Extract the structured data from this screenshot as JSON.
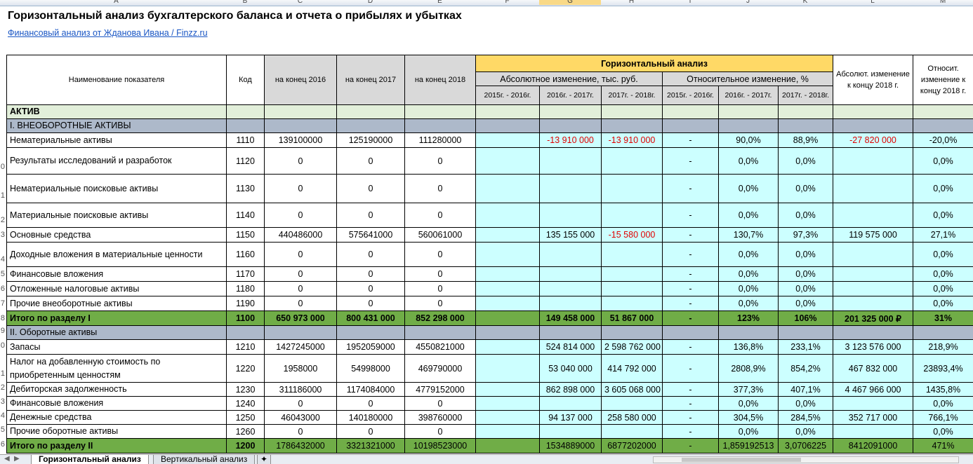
{
  "sheet": {
    "col_letters": [
      "A",
      "B",
      "C",
      "D",
      "E",
      "F",
      "G",
      "H",
      "I",
      "J",
      "K",
      "L",
      "M"
    ],
    "selected_col": "G",
    "title": "Горизонтальный анализ бухгалтерского баланса и отчета о прибылях и убытках",
    "link": "Финансовый анализ от Жданова Ивана / Finzz.ru"
  },
  "header": {
    "name": "Наименование показателя",
    "code": "Код",
    "y2016": "на конец 2016",
    "y2017": "на конец 2017",
    "y2018": "на конец 2018",
    "horizontal": "Горизонтальный анализ",
    "abs_change": "Абсолютное изменение, тыс. руб.",
    "rel_change": "Относительное изменение, %",
    "abs_2018": "Абсолют. изменение к концу 2018 г.",
    "rel_2018": "Относит. изменение к концу 2018 г.",
    "abs_periods": [
      "2015г. - 2016г.",
      "2016г. - 2017г.",
      "2017г. - 2018г."
    ],
    "rel_periods": [
      "2015г. - 2016г.",
      "2016г. - 2017г.",
      "2017г. - 2018г."
    ]
  },
  "rows": [
    {
      "type": "aktiv",
      "name": "АКТИВ",
      "rownum": ""
    },
    {
      "type": "section",
      "name": "I. ВНЕОБОРОТНЫЕ АКТИВЫ",
      "rownum": ""
    },
    {
      "type": "data",
      "rownum": "",
      "name": "Нематериальные активы",
      "code": "1110",
      "v16": "139100000",
      "v17": "125190000",
      "v18": "111280000",
      "a1": "",
      "a2": "-13 910 000",
      "a3": "-13 910 000",
      "r1": "-",
      "r2": "90,0%",
      "r3": "88,9%",
      "ab": "-27 820 000",
      "rel": "-20,0%",
      "neg": [
        "a2",
        "a3",
        "ab"
      ],
      "h": 21
    },
    {
      "type": "data",
      "rownum": "0",
      "name": "Результаты исследований и разработок",
      "code": "1120",
      "v16": "0",
      "v17": "0",
      "v18": "0",
      "a1": "",
      "a2": "",
      "a3": "",
      "r1": "-",
      "r2": "0,0%",
      "r3": "0,0%",
      "ab": "",
      "rel": "0,0%",
      "h": 38
    },
    {
      "type": "data",
      "rownum": "1",
      "name": "Нематериальные поисковые активы",
      "code": "1130",
      "v16": "0",
      "v17": "0",
      "v18": "0",
      "a1": "",
      "a2": "",
      "a3": "",
      "r1": "-",
      "r2": "0,0%",
      "r3": "0,0%",
      "ab": "",
      "rel": "0,0%",
      "h": 41
    },
    {
      "type": "data",
      "rownum": "2",
      "name": "Материальные поисковые активы",
      "code": "1140",
      "v16": "0",
      "v17": "0",
      "v18": "0",
      "a1": "",
      "a2": "",
      "a3": "",
      "r1": "-",
      "r2": "0,0%",
      "r3": "0,0%",
      "ab": "",
      "rel": "0,0%",
      "h": 35
    },
    {
      "type": "data",
      "rownum": "3",
      "name": "Основные средства",
      "code": "1150",
      "v16": "440486000",
      "v17": "575641000",
      "v18": "560061000",
      "a1": "",
      "a2": "135 155 000",
      "a3": "-15 580 000",
      "r1": "-",
      "r2": "130,7%",
      "r3": "97,3%",
      "ab": "119 575 000",
      "rel": "27,1%",
      "neg": [
        "a3"
      ],
      "h": 21
    },
    {
      "type": "data",
      "rownum": "4",
      "name": "Доходные вложения в материальные ценности",
      "code": "1160",
      "v16": "0",
      "v17": "0",
      "v18": "0",
      "a1": "",
      "a2": "",
      "a3": "",
      "r1": "-",
      "r2": "0,0%",
      "r3": "0,0%",
      "ab": "",
      "rel": "0,0%",
      "h": 35
    },
    {
      "type": "data",
      "rownum": "5",
      "name": "Финансовые вложения",
      "code": "1170",
      "v16": "0",
      "v17": "0",
      "v18": "0",
      "a1": "",
      "a2": "",
      "a3": "",
      "r1": "-",
      "r2": "0,0%",
      "r3": "0,0%",
      "ab": "",
      "rel": "0,0%",
      "h": 21
    },
    {
      "type": "data",
      "rownum": "6",
      "name": "Отложенные налоговые активы",
      "code": "1180",
      "v16": "0",
      "v17": "0",
      "v18": "0",
      "a1": "",
      "a2": "",
      "a3": "",
      "r1": "-",
      "r2": "0,0%",
      "r3": "0,0%",
      "ab": "",
      "rel": "0,0%",
      "h": 21
    },
    {
      "type": "data",
      "rownum": "7",
      "name": "Прочие внеоборотные активы",
      "code": "1190",
      "v16": "0",
      "v17": "0",
      "v18": "0",
      "a1": "",
      "a2": "",
      "a3": "",
      "r1": "-",
      "r2": "0,0%",
      "r3": "0,0%",
      "ab": "",
      "rel": "0,0%",
      "h": 21
    },
    {
      "type": "total",
      "rownum": "8",
      "name": "Итого по разделу I",
      "code": "1100",
      "v16": "650 973 000",
      "v17": "800 431 000",
      "v18": "852 298 000",
      "a1": "",
      "a2": "149 458 000",
      "a3": "51 867 000",
      "r1": "-",
      "r2": "123%",
      "r3": "106%",
      "ab": "201 325 000 ₽",
      "rel": "31%",
      "h": 21
    },
    {
      "type": "section",
      "rownum": "9",
      "name": "II. Оборотные активы"
    },
    {
      "type": "data",
      "rownum": "0",
      "name": "Запасы",
      "code": "1210",
      "small": true,
      "v16": "1427245000",
      "v17": "1952059000",
      "v18": "4550821000",
      "a1": "",
      "a2": "524 814 000",
      "a3": "2 598 762 000",
      "r1": "-",
      "r2": "136,8%",
      "r3": "233,1%",
      "ab": "3 123 576 000",
      "rel": "218,9%",
      "h": 21
    },
    {
      "type": "data",
      "rownum": "1",
      "name": "Налог на добавленную стоимость по приобретенным ценностям",
      "code": "1220",
      "small": true,
      "v16": "1958000",
      "v17": "54998000",
      "v18": "469790000",
      "a1": "",
      "a2": "53 040 000",
      "a3": "414 792 000",
      "r1": "-",
      "r2": "2808,9%",
      "r3": "854,2%",
      "ab": "467 832 000",
      "rel": "23893,4%",
      "h": 40
    },
    {
      "type": "data",
      "rownum": "2",
      "name": "Дебиторская задолженность",
      "code": "1230",
      "small": true,
      "v16": "311186000",
      "v17": "1174084000",
      "v18": "4779152000",
      "a1": "",
      "a2": "862 898 000",
      "a3": "3 605 068 000",
      "r1": "-",
      "r2": "377,3%",
      "r3": "407,1%",
      "ab": "4 467 966 000",
      "rel": "1435,8%",
      "h": 20
    },
    {
      "type": "data",
      "rownum": "3",
      "name": "Финансовые вложения",
      "code": "1240",
      "small": true,
      "v16": "0",
      "v17": "0",
      "v18": "0",
      "a1": "",
      "a2": "",
      "a3": "",
      "r1": "-",
      "r2": "0,0%",
      "r3": "0,0%",
      "ab": "",
      "rel": "0,0%",
      "h": 20
    },
    {
      "type": "data",
      "rownum": "4",
      "name": "Денежные средства",
      "code": "1250",
      "small": true,
      "v16": "46043000",
      "v17": "140180000",
      "v18": "398760000",
      "a1": "",
      "a2": "94 137 000",
      "a3": "258 580 000",
      "r1": "-",
      "r2": "304,5%",
      "r3": "284,5%",
      "ab": "352 717 000",
      "rel": "766,1%",
      "h": 20
    },
    {
      "type": "data",
      "rownum": "5",
      "name": "Прочие оборотные активы",
      "code": "1260",
      "small": true,
      "v16": "0",
      "v17": "0",
      "v18": "0",
      "a1": "",
      "a2": "",
      "a3": "",
      "r1": "-",
      "r2": "0,0%",
      "r3": "0,0%",
      "ab": "",
      "rel": "0,0%",
      "h": 20
    },
    {
      "type": "total",
      "rownum": "6",
      "name": "Итого по разделу II",
      "code": "1200",
      "v16": "1786432000",
      "v17": "3321321000",
      "v18": "10198523000",
      "a1": "",
      "a2": "1534889000",
      "a3": "6877202000",
      "r1": "-",
      "r2": "1,859192513",
      "r3": "3,0706225",
      "ab": "8412091000",
      "rel": "471%",
      "normal": true,
      "h": 21
    }
  ],
  "tabs": {
    "active": "Горизонтальный анализ",
    "other": "Вертикальный анализ"
  }
}
